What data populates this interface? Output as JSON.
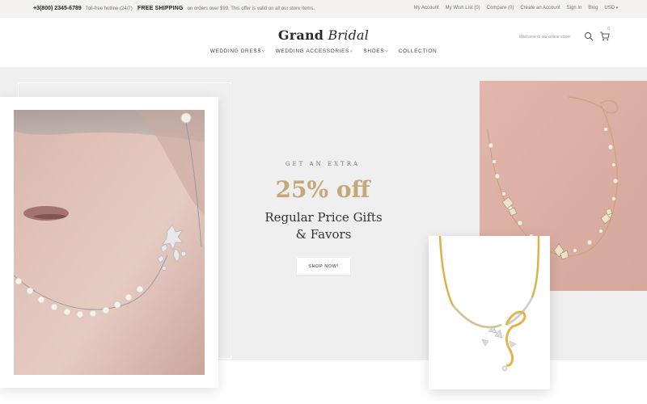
{
  "topbar": {
    "phone": "+3(800) 2345-6789",
    "phone_hint": "Toll-free hotline (24/7)",
    "shipping_strong": "FREE SHIPPING",
    "shipping_note": "on orders over $99. This offer is valid on all our store items.",
    "links": [
      "My Account",
      "My Wish List (0)",
      "Compare (0)",
      "Create an Account",
      "Sign In",
      "Blog",
      "USD"
    ]
  },
  "header": {
    "logo_bold": "Grand",
    "logo_italic": "Bridal",
    "welcome": "Welcome to our online store!",
    "cart_count": "0",
    "nav": [
      {
        "label": "WEDDING DRESS",
        "caret": "˅"
      },
      {
        "label": "WEDDING ACCESSORIES",
        "caret": "˅"
      },
      {
        "label": "SHOES",
        "caret": "˅"
      },
      {
        "label": "COLLECTION",
        "caret": ""
      }
    ]
  },
  "hero": {
    "pre_title": "GET AN EXTRA",
    "discount": "25% off",
    "title_line1": "Regular Price Gifts",
    "title_line2": "& Favors",
    "button": "SHOP NOW!"
  },
  "colors": {
    "accent_gold": "#c3a97a",
    "hero_bg": "#efefef",
    "topbar_bg": "#f3f2f0"
  }
}
